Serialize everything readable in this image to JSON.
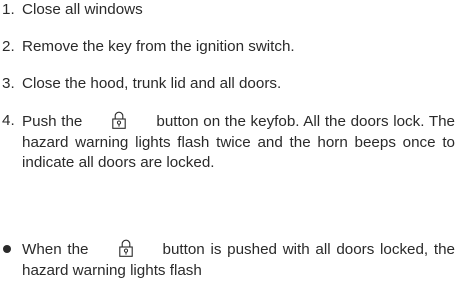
{
  "steps": [
    {
      "num": "1.",
      "text": "Close all windows"
    },
    {
      "num": "2.",
      "text": "Remove the key from the ignition switch."
    },
    {
      "num": "3.",
      "text": "Close the hood, trunk lid and all doors."
    },
    {
      "num": "4.",
      "pre": "Push the",
      "icon": "lock-icon",
      "post": "button on the keyfob. All the doors lock. The hazard warning lights flash twice and the horn beeps once to indicate all doors are locked."
    }
  ],
  "bullet": {
    "pre": "When the",
    "icon": "lock-icon",
    "post": "button is pushed with all doors locked, the hazard warning lights flash"
  }
}
